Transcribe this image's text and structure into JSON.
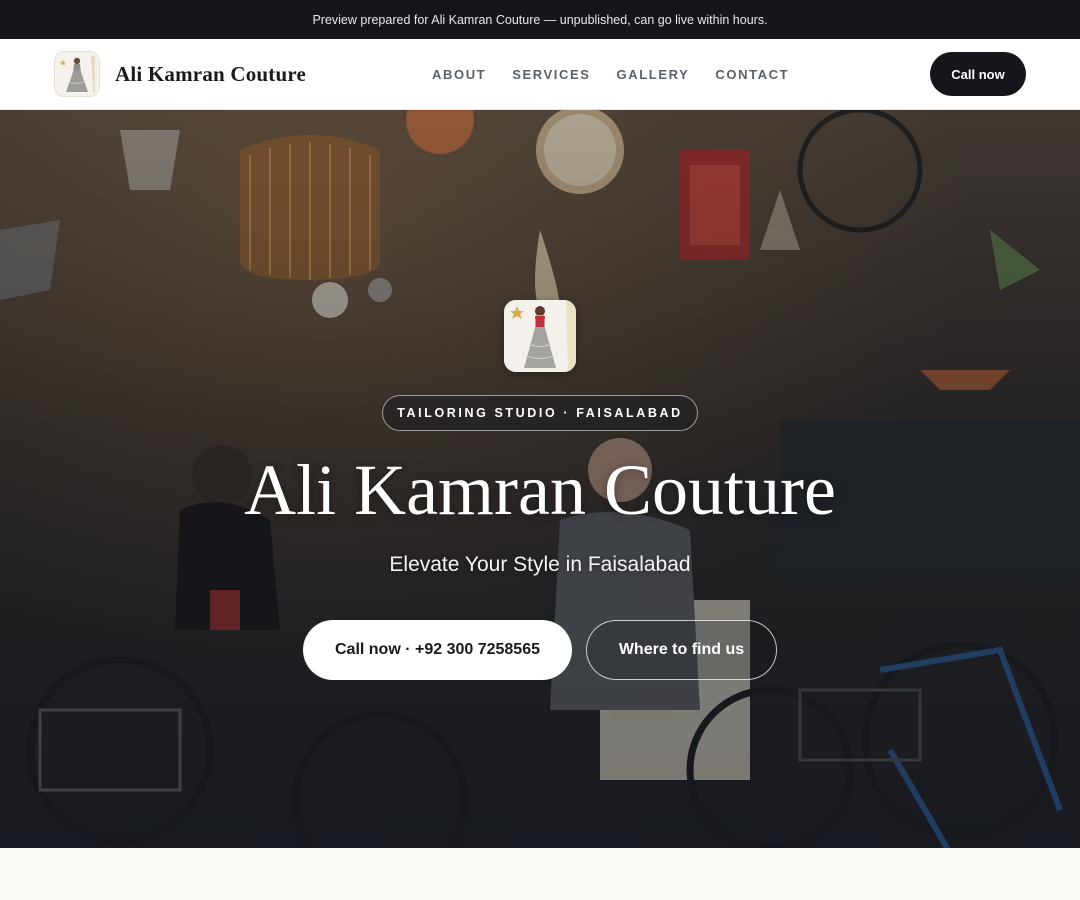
{
  "preview_banner": {
    "text": "Preview prepared for Ali Kamran Couture — unpublished, can go live within hours."
  },
  "nav": {
    "brand_name": "Ali Kamran Couture",
    "logo_icon": "bridal-dress-logo-icon",
    "links": [
      "ABOUT",
      "SERVICES",
      "GALLERY",
      "CONTACT"
    ],
    "call_label": "Call now"
  },
  "hero": {
    "background_image": "antique-shop-street-photo",
    "logo_icon": "bridal-dress-logo-icon",
    "badge": "TAILORING STUDIO · FAISALABAD",
    "title": "Ali Kamran Couture",
    "subtitle": "Elevate Your Style in Faisalabad",
    "primary_cta": "Call now · +92 300 7258565",
    "secondary_cta": "Where to find us"
  },
  "colors": {
    "top_bar": "#14161c",
    "nav_button": "#15161b",
    "page_background": "#faf9f6",
    "hero_text": "#ffffff"
  }
}
